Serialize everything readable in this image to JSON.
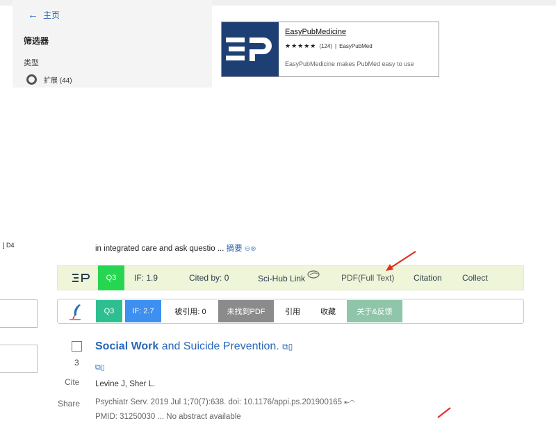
{
  "store": {
    "back_label": "主页",
    "filter_title": "筛选器",
    "type_label": "类型",
    "radio_option": "扩展 (44)",
    "extension": {
      "name": "EasyPubMedicine",
      "rating": "★★★★★",
      "rating_count": "(124)",
      "publisher": "EasyPubMed",
      "description": "EasyPubMedicine makes PubMed easy to use",
      "brand_color": "#1d3f73"
    }
  },
  "pubmed": {
    "left_fragment": "] D4",
    "abstract_snippet": "in integrated care and ask questio ...",
    "abstract_link": "摘要",
    "toolbar_en": {
      "logo": "EP",
      "quartile": "Q3",
      "impact_factor": "IF:  1.9",
      "cited_by": "Cited by:  0",
      "scihub": "Sci-Hub Link",
      "pdf": "PDF(Full Text)",
      "citation": "Citation",
      "collect": "Collect"
    },
    "toolbar_cn": {
      "quartile": "Q3",
      "impact_factor": "IF: 2.7",
      "cited_by": "被引用: 0",
      "pdf_not_found": "未找到PDF",
      "cite": "引用",
      "collect": "收藏",
      "about": "关于&反馈"
    },
    "result": {
      "title_bold": "Social Work",
      "title_rest": " and Suicide Prevention.",
      "number": "3",
      "cite_label": "Cite",
      "share_label": "Share",
      "authors": "Levine J, Sher L.",
      "citation_text": "Psychiatr Serv. 2019 Jul 1;70(7):638. doi: 10.1176/appi.ps.201900165",
      "pmid_fragment": "PMID: 31250030  ...  No abstract available"
    },
    "colors": {
      "green": "#27d650",
      "teal": "#2ebf91",
      "blue": "#3d8ff0",
      "gray": "#8b8b8b",
      "sage": "#8fc5a8",
      "arrow_red": "#e0301e",
      "link_blue": "#2667b8"
    }
  }
}
